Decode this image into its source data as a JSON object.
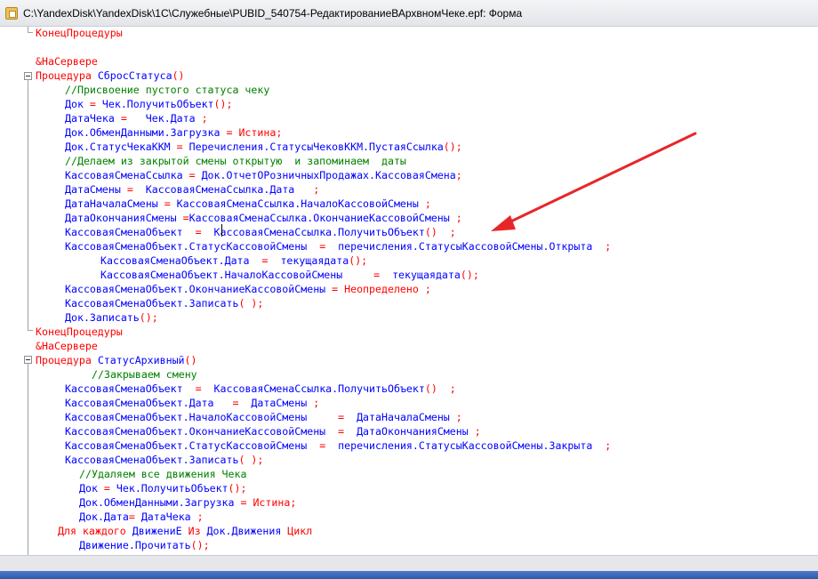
{
  "window": {
    "title": "C:\\YandexDisk\\YandexDisk\\1С\\Служебные\\PUBID_540754-РедактированиеВАрхвномЧеке.epf: Форма",
    "icon": "1c-form-icon"
  },
  "colors": {
    "keyword": "#ff0000",
    "comment": "#008000",
    "identifier": "#0000ff",
    "arrow": "#e8262a"
  },
  "code": {
    "l1": {
      "a": "КонецПроцедуры"
    },
    "l2": {
      "a": "&НаСервере"
    },
    "l3": {
      "a": "Процедура ",
      "b": "СбросСтатуса",
      "c": "()"
    },
    "l4": {
      "a": "//Присвоение пустого статуса чеку"
    },
    "l5": {
      "a": "Док ",
      "b": "= ",
      "c": "Чек.ПолучитьОбъект",
      "d": "();"
    },
    "l6": {
      "a": "ДатаЧека ",
      "b": "=   ",
      "c": "Чек.Дата ",
      "d": ";"
    },
    "l7": {
      "a": "Док.ОбменДанными.Загрузка ",
      "b": "= Истина;"
    },
    "l8": {
      "a": "Док.СтатусЧекаККМ ",
      "b": "= ",
      "c": "Перечисления.СтатусыЧековККМ.ПустаяСсылка",
      "d": "();"
    },
    "l9": {
      "a": "//Делаем из закрытой смены открытую  и запоминаем  даты"
    },
    "l10": {
      "a": "КассоваяСменаСсылка ",
      "b": "= ",
      "c": "Док.ОтчетОРозничныхПродажах.КассоваяСмена",
      "d": ";"
    },
    "l11": {
      "a": "ДатаСмены ",
      "b": "=  ",
      "c": "КассоваяСменаСсылка.Дата   ",
      "d": ";"
    },
    "l12": {
      "a": "ДатаНачалаСмены ",
      "b": "= ",
      "c": "КассоваяСменаСсылка.НачалоКассовойСмены ",
      "d": ";"
    },
    "l13": {
      "a": "ДатаОкончанияСмены ",
      "b": "=",
      "c": "КассоваяСменаСсылка.ОкончаниеКассовойСмены ",
      "d": ";"
    },
    "l14": {
      "a": "КассоваяСменаОбъект  ",
      "b": "=  ",
      "c": "КассоваяСменаСсылка.ПолучитьОбъект",
      "d": "()  ;"
    },
    "l15": {
      "a": "КассоваяСменаОбъект.СтатусКассовойСмены  ",
      "b": "=  ",
      "c": "перечисления.СтатусыКассовойСмены.Открыта  ",
      "d": ";"
    },
    "l16": {
      "a": "КассоваяСменаОбъект.Дата  ",
      "b": "=  ",
      "c": "текущаядата",
      "d": "();"
    },
    "l17": {
      "a": "КассоваяСменаОбъект.НачалоКассовойСмены     ",
      "b": "=  ",
      "c": "текущаядата",
      "d": "();"
    },
    "l18": {
      "a": "КассоваяСменаОбъект.ОкончаниеКассовойСмены ",
      "b": "= Неопределено ;"
    },
    "l19": {
      "a": "КассоваяСменаОбъект.Записать",
      "b": "( );"
    },
    "l20": {
      "a": "Док.Записать",
      "b": "();"
    },
    "l21": {
      "a": "КонецПроцедуры"
    },
    "l22": {
      "a": "&НаСервере"
    },
    "l23": {
      "a": "Процедура ",
      "b": "СтатусАрхивный",
      "c": "()"
    },
    "l24": {
      "a": "//Закрываем смену"
    },
    "l25": {
      "a": "КассоваяСменаОбъект  ",
      "b": "=  ",
      "c": "КассоваяСменаСсылка.ПолучитьОбъект",
      "d": "()  ;"
    },
    "l26": {
      "a": "КассоваяСменаОбъект.Дата   ",
      "b": "=  ",
      "c": "ДатаСмены ",
      "d": ";"
    },
    "l27": {
      "a": "КассоваяСменаОбъект.НачалоКассовойСмены     ",
      "b": "=  ",
      "c": "ДатаНачалаСмены ",
      "d": ";"
    },
    "l28": {
      "a": "КассоваяСменаОбъект.ОкончаниеКассовойСмены  ",
      "b": "=  ",
      "c": "ДатаОкончанияСмены ",
      "d": ";"
    },
    "l29": {
      "a": "КассоваяСменаОбъект.СтатусКассовойСмены  ",
      "b": "=  ",
      "c": "перечисления.СтатусыКассовойСмены.Закрыта  ",
      "d": ";"
    },
    "l30": {
      "a": "КассоваяСменаОбъект.Записать",
      "b": "( );"
    },
    "l31": {
      "a": "//Удаляем все движения Чека"
    },
    "l32": {
      "a": "Док ",
      "b": "= ",
      "c": "Чек.ПолучитьОбъект",
      "d": "();"
    },
    "l33": {
      "a": "Док.ОбменДанными.Загрузка ",
      "b": "= Истина;"
    },
    "l34": {
      "a": "Док.Дата",
      "b": "= ",
      "c": "ДатаЧека ",
      "d": ";"
    },
    "l35": {
      "a": "Для каждого ",
      "b": "ДвижениЕ ",
      "c": "Из ",
      "d": "Док.Движения ",
      "e": "Цикл"
    },
    "l36": {
      "a": "Движение.Прочитать",
      "b": "();"
    }
  }
}
